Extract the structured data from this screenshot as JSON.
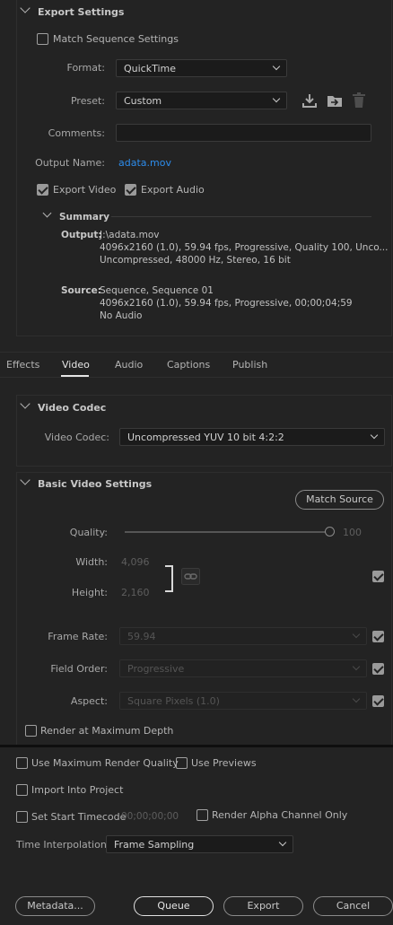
{
  "export_settings": {
    "title": "Export Settings",
    "match_sequence": {
      "label": "Match Sequence Settings",
      "checked": false
    },
    "format": {
      "label": "Format:",
      "value": "QuickTime"
    },
    "preset": {
      "label": "Preset:",
      "value": "Custom"
    },
    "comments": {
      "label": "Comments:",
      "value": ""
    },
    "output_name": {
      "label": "Output Name:",
      "value": "adata.mov"
    },
    "export_video": {
      "label": "Export Video",
      "checked": true
    },
    "export_audio": {
      "label": "Export Audio",
      "checked": true
    },
    "summary": {
      "title": "Summary",
      "output_label": "Output:",
      "output_lines": [
        "J:\\adata.mov",
        "4096x2160 (1.0), 59.94 fps, Progressive, Quality 100, Unco...",
        "Uncompressed, 48000 Hz, Stereo, 16 bit"
      ],
      "source_label": "Source:",
      "source_lines": [
        "Sequence, Sequence 01",
        "4096x2160 (1.0), 59.94 fps, Progressive, 00;00;04;59",
        "No Audio"
      ]
    }
  },
  "tabs": [
    {
      "label": "Effects",
      "active": false
    },
    {
      "label": "Video",
      "active": true
    },
    {
      "label": "Audio",
      "active": false
    },
    {
      "label": "Captions",
      "active": false
    },
    {
      "label": "Publish",
      "active": false
    }
  ],
  "video_codec": {
    "title": "Video Codec",
    "label": "Video Codec:",
    "value": "Uncompressed YUV 10 bit 4:2:2"
  },
  "basic_video": {
    "title": "Basic Video Settings",
    "match_source_label": "Match Source",
    "quality": {
      "label": "Quality:",
      "value": "100"
    },
    "width": {
      "label": "Width:",
      "value": "4,096"
    },
    "height": {
      "label": "Height:",
      "value": "2,160"
    },
    "frame_rate": {
      "label": "Frame Rate:",
      "value": "59.94"
    },
    "field_order": {
      "label": "Field Order:",
      "value": "Progressive"
    },
    "aspect": {
      "label": "Aspect:",
      "value": "Square Pixels (1.0)"
    },
    "render_max_depth": {
      "label": "Render at Maximum Depth",
      "checked": false
    }
  },
  "bottom": {
    "use_max_render_quality": {
      "label": "Use Maximum Render Quality",
      "checked": false
    },
    "use_previews": {
      "label": "Use Previews",
      "checked": false
    },
    "import_into_project": {
      "label": "Import Into Project",
      "checked": false
    },
    "set_start_timecode": {
      "label": "Set Start Timecode",
      "checked": false,
      "value": "00;00;00;00"
    },
    "render_alpha": {
      "label": "Render Alpha Channel Only",
      "checked": false
    },
    "time_interpolation": {
      "label": "Time Interpolation:",
      "value": "Frame Sampling"
    },
    "buttons": {
      "metadata": "Metadata...",
      "queue": "Queue",
      "export": "Export",
      "cancel": "Cancel"
    }
  },
  "colors": {
    "background": "#232323",
    "link": "#2d8ceb",
    "text": "#b4b4b4"
  }
}
